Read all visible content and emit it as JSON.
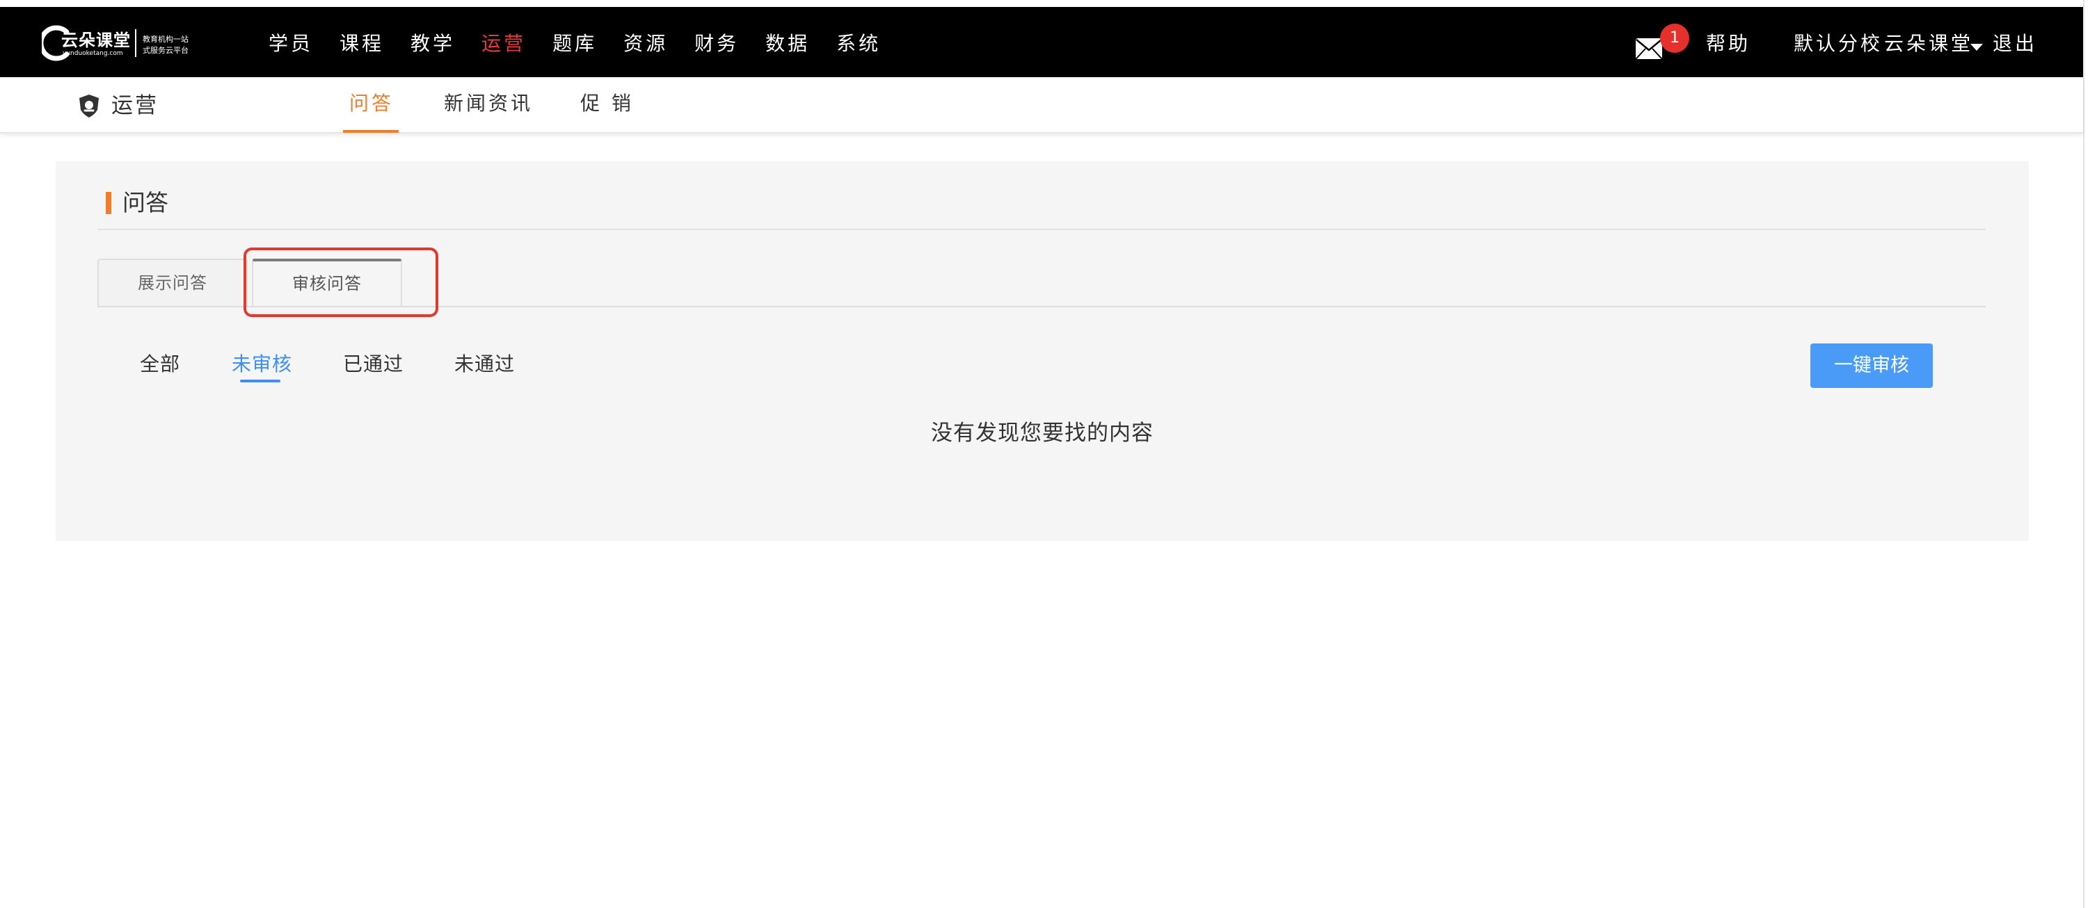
{
  "logo": {
    "name": "云朵课堂",
    "domain": "yunduoketang.com",
    "slogan_line1": "教育机构一站",
    "slogan_line2": "式服务云平台"
  },
  "top_nav": {
    "items": [
      {
        "label": "学员",
        "active": false
      },
      {
        "label": "课程",
        "active": false
      },
      {
        "label": "教学",
        "active": false
      },
      {
        "label": "运营",
        "active": true
      },
      {
        "label": "题库",
        "active": false
      },
      {
        "label": "资源",
        "active": false
      },
      {
        "label": "财务",
        "active": false
      },
      {
        "label": "数据",
        "active": false
      },
      {
        "label": "系统",
        "active": false
      }
    ],
    "active_color": "#e43c3c"
  },
  "header_right": {
    "mail_icon": "mail-icon",
    "mail_badge_count": "1",
    "help": "帮助",
    "branch": "默认分校",
    "account": "云朵课堂",
    "logout": "退出"
  },
  "subnav": {
    "section_icon": "shield-icon",
    "section_title": "运营",
    "items": [
      {
        "label": "问答",
        "active": true
      },
      {
        "label": "新闻资讯",
        "active": false
      },
      {
        "label": "促 销",
        "active": false
      }
    ],
    "accent_color": "#f07d2c"
  },
  "panel": {
    "title": "问答",
    "tabs": [
      {
        "label": "展示问答",
        "active": false
      },
      {
        "label": "审核问答",
        "active": true
      }
    ],
    "filters": [
      {
        "label": "全部",
        "active": false
      },
      {
        "label": "未审核",
        "active": true
      },
      {
        "label": "已通过",
        "active": false
      },
      {
        "label": "未通过",
        "active": false
      }
    ],
    "filter_active_color": "#3d8ff5",
    "action_button": "一键审核",
    "empty_message": "没有发现您要找的内容"
  },
  "annotation": {
    "highlight_color": "#e03a2e"
  }
}
